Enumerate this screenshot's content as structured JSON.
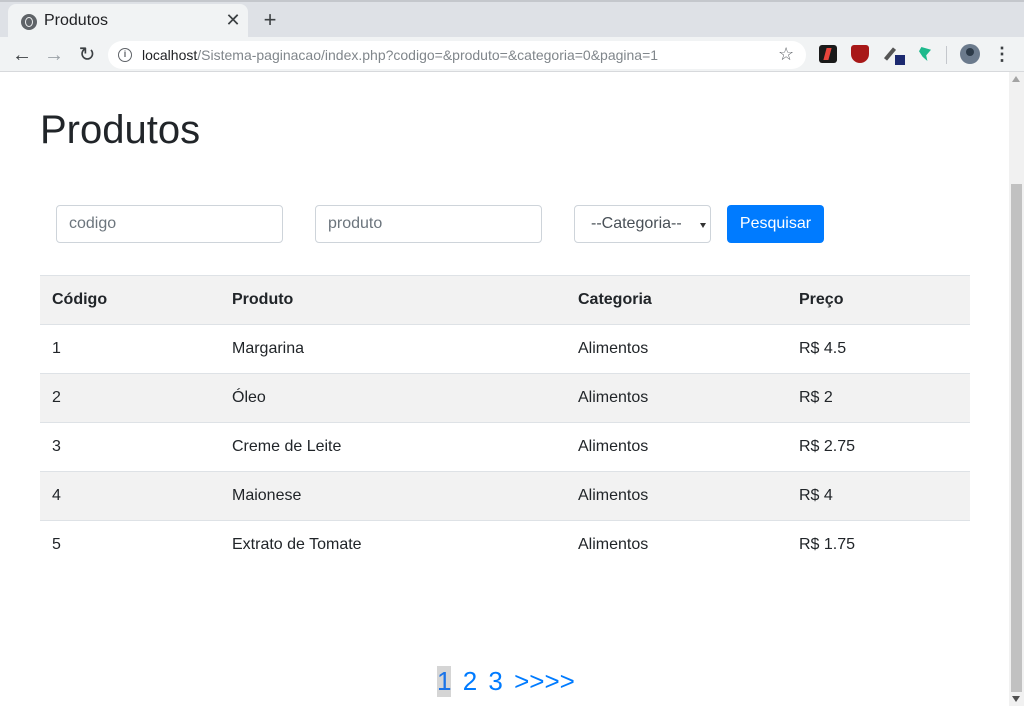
{
  "browser": {
    "tab_title": "Produtos",
    "tab_close": "✕",
    "new_tab": "+",
    "url_host": "localhost",
    "url_path": "/Sistema-paginacao/index.php?codigo=&produto=&categoria=0&pagina=1",
    "back": "←",
    "forward": "→",
    "reload": "↻",
    "info": "i",
    "star": "☆",
    "menu": "⋮"
  },
  "page": {
    "title": "Produtos"
  },
  "search": {
    "codigo_placeholder": "codigo",
    "produto_placeholder": "produto",
    "categoria_selected": "--Categoria--",
    "submit_label": "Pesquisar"
  },
  "table": {
    "headers": [
      "Código",
      "Produto",
      "Categoria",
      "Preço"
    ],
    "rows": [
      [
        "1",
        "Margarina",
        "Alimentos",
        "R$ 4.5"
      ],
      [
        "2",
        "Óleo",
        "Alimentos",
        "R$ 2"
      ],
      [
        "3",
        "Creme de Leite",
        "Alimentos",
        "R$ 2.75"
      ],
      [
        "4",
        "Maionese",
        "Alimentos",
        "R$ 4"
      ],
      [
        "5",
        "Extrato de Tomate",
        "Alimentos",
        "R$ 1.75"
      ]
    ]
  },
  "pagination": {
    "pages": [
      "1",
      "2",
      "3"
    ],
    "next": ">>>>",
    "current": "1"
  },
  "colors": {
    "primary": "#007bff",
    "stripe": "#f2f2f2"
  }
}
